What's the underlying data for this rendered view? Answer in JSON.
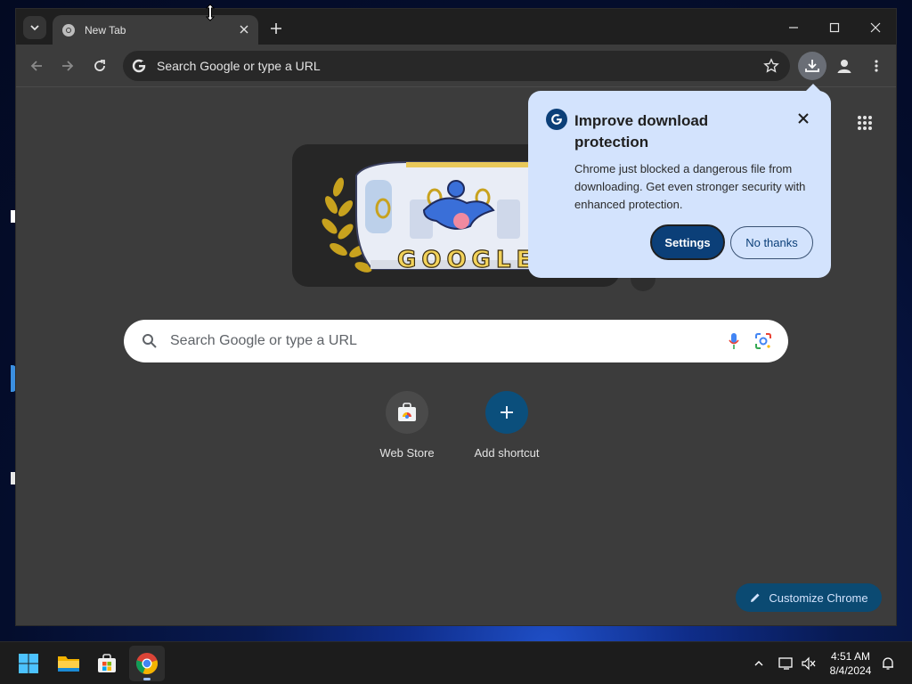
{
  "browser": {
    "tab_title": "New Tab",
    "omnibox_text": "Search Google or type a URL"
  },
  "new_tab_page": {
    "search_placeholder": "Search Google or type a URL",
    "doodle_text": "GOOGLE",
    "shortcuts": [
      {
        "label": "Web Store",
        "icon": "web-store-icon"
      },
      {
        "label": "Add shortcut",
        "icon": "plus-icon"
      }
    ],
    "customize_label": "Customize Chrome"
  },
  "download_bubble": {
    "title": "Improve download protection",
    "body": "Chrome just blocked a dangerous file from downloading. Get even stronger security with enhanced protection.",
    "primary_button": "Settings",
    "secondary_button": "No thanks"
  },
  "taskbar": {
    "time": "4:51 AM",
    "date": "8/4/2024",
    "apps": [
      "start-icon",
      "file-explorer-icon",
      "microsoft-store-icon",
      "chrome-icon"
    ]
  },
  "colors": {
    "accent": "#0b3f78",
    "bubble_bg": "#d3e3fd",
    "browser_bg": "#3c3c3c",
    "shortcut_add_bg": "#0b4f7c"
  }
}
